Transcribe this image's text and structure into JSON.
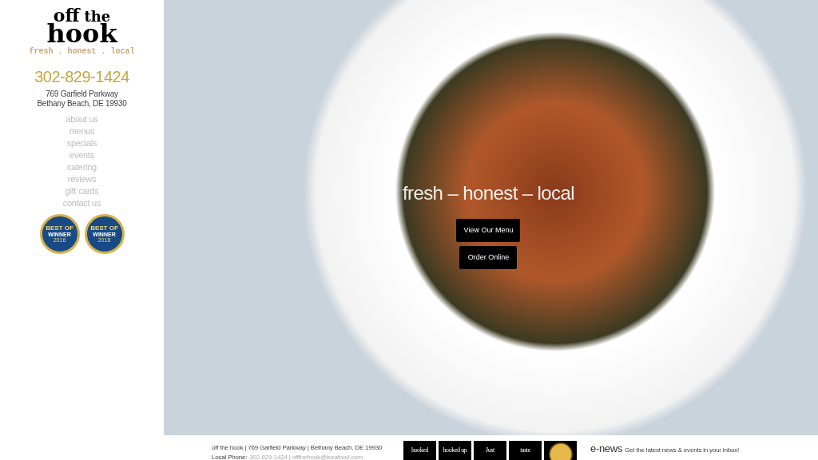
{
  "logo": {
    "words": [
      "off",
      "the",
      "hook"
    ],
    "tagline": "fresh . honest . local"
  },
  "phone": "302-829-1424",
  "address": [
    "769 Garfield Parkway",
    "Bethany Beach, DE 19930"
  ],
  "nav": [
    {
      "label": "about us"
    },
    {
      "label": "menus"
    },
    {
      "label": "specials"
    },
    {
      "label": "events"
    },
    {
      "label": "catering"
    },
    {
      "label": "reviews"
    },
    {
      "label": "gift cards"
    },
    {
      "label": "contact us"
    }
  ],
  "awards": [
    {
      "heading": "BEST OF",
      "sub": "WINNER",
      "year": "2016"
    },
    {
      "heading": "BEST OF",
      "sub": "WINNER",
      "year": "2018"
    }
  ],
  "hero": {
    "tagline": "fresh – honest – local",
    "buttons": [
      "View Our Menu",
      "Order Online"
    ]
  },
  "footer": {
    "line1": "off the hook | 769 Garfield Parkway | Bethany Beach, DE 19930",
    "phone_label": "Local Phone:",
    "phone_value": "302-829-1424 | offthehook@iseafood.com",
    "tiles": [
      {
        "kind": "text",
        "label": "hooked"
      },
      {
        "kind": "text",
        "label": "hooked up"
      },
      {
        "kind": "text",
        "label": "Just"
      },
      {
        "kind": "text",
        "label": "taste"
      },
      {
        "kind": "emblem"
      }
    ],
    "enews_title": "e-news",
    "enews_text": "Get the latest news & events in your inbox!"
  }
}
